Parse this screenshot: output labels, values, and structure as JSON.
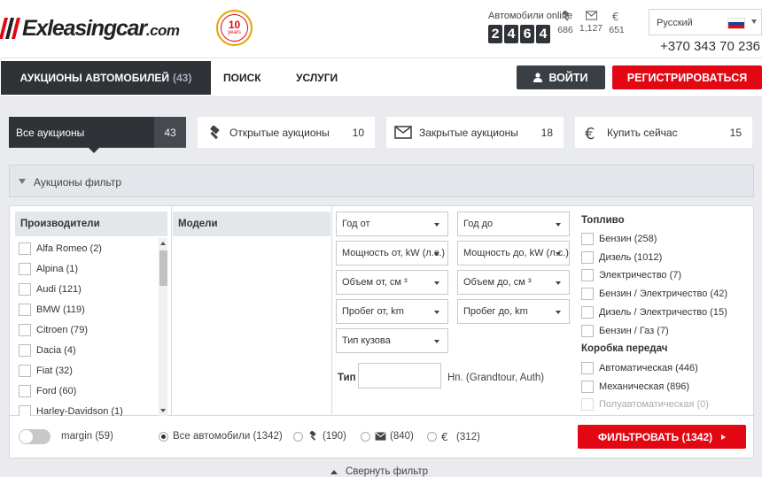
{
  "header": {
    "logo_text": "Exleasingcar",
    "logo_domain": ".com",
    "logo_bar_colors": [
      "#e30613",
      "#222222",
      "#e30613"
    ],
    "badge_number": "10",
    "badge_text": "years",
    "online_title": "Автомобили online",
    "online_digits": [
      "2",
      "4",
      "6",
      "4"
    ],
    "stats": [
      {
        "icon": "gavel-icon",
        "value": "686"
      },
      {
        "icon": "envelope-icon",
        "value": "1,127"
      },
      {
        "icon": "euro-icon",
        "value": "651"
      }
    ],
    "language": "Русский",
    "phone": "+370 343 70 236"
  },
  "nav": {
    "auctions_label": "АУКЦИОНЫ АВТОМОБИЛЕЙ",
    "auctions_count": "(43)",
    "search_label": "ПОИСК",
    "services_label": "УСЛУГИ",
    "login_label": "ВОЙТИ",
    "register_label": "РЕГИСТРИРОВАТЬСЯ"
  },
  "tabs": [
    {
      "label": "Все аукционы",
      "count": "43"
    },
    {
      "label": "Открытые аукционы",
      "count": "10"
    },
    {
      "label": "Закрытые аукционы",
      "count": "18"
    },
    {
      "label": "Купить сейчас",
      "count": "15"
    }
  ],
  "filter": {
    "title": "Аукционы фильтр",
    "manufacturers_title": "Производители",
    "models_title": "Модели",
    "manufacturers": [
      "Alfa Romeo (2)",
      "Alpina (1)",
      "Audi (121)",
      "BMW (119)",
      "Citroen (79)",
      "Dacia (4)",
      "Fiat (32)",
      "Ford (60)",
      "Harley-Davidson (1)"
    ],
    "selects_left": [
      "Год от",
      "Мощность от, kW (л.с.)",
      "Объем от, см ³",
      "Пробег от, km",
      "Тип кузова"
    ],
    "selects_right": [
      "Год до",
      "Мощность до, kW (л.с.)",
      "Объем до, см ³",
      "Пробег до, km"
    ],
    "type_label": "Тип",
    "type_hint": "Нп. (Grandtour, Auth)",
    "fuel_title": "Топливо",
    "fuel": [
      "Бензин (258)",
      "Дизель (1012)",
      "Электричество (7)",
      "Бензин / Электричество (42)",
      "Дизель / Электричество (15)",
      "Бензин / Газ (7)"
    ],
    "gearbox_title": "Коробка передач",
    "gearbox": [
      "Автоматическая (446)",
      "Механическая (896)",
      "Полуавтоматическая (0)"
    ]
  },
  "bottom": {
    "margin_label": "margin (59)",
    "all_cars": "Все автомобили",
    "all_cars_count": "(1342)",
    "open_count": "(190)",
    "closed_count": "(840)",
    "buy_count": "(312)",
    "filter_button": "ФИЛЬТРОВАТЬ (1342)",
    "collapse_label": "Свернуть фильтр"
  },
  "colors": {
    "accent": "#e30613",
    "dark": "#2f3338"
  }
}
